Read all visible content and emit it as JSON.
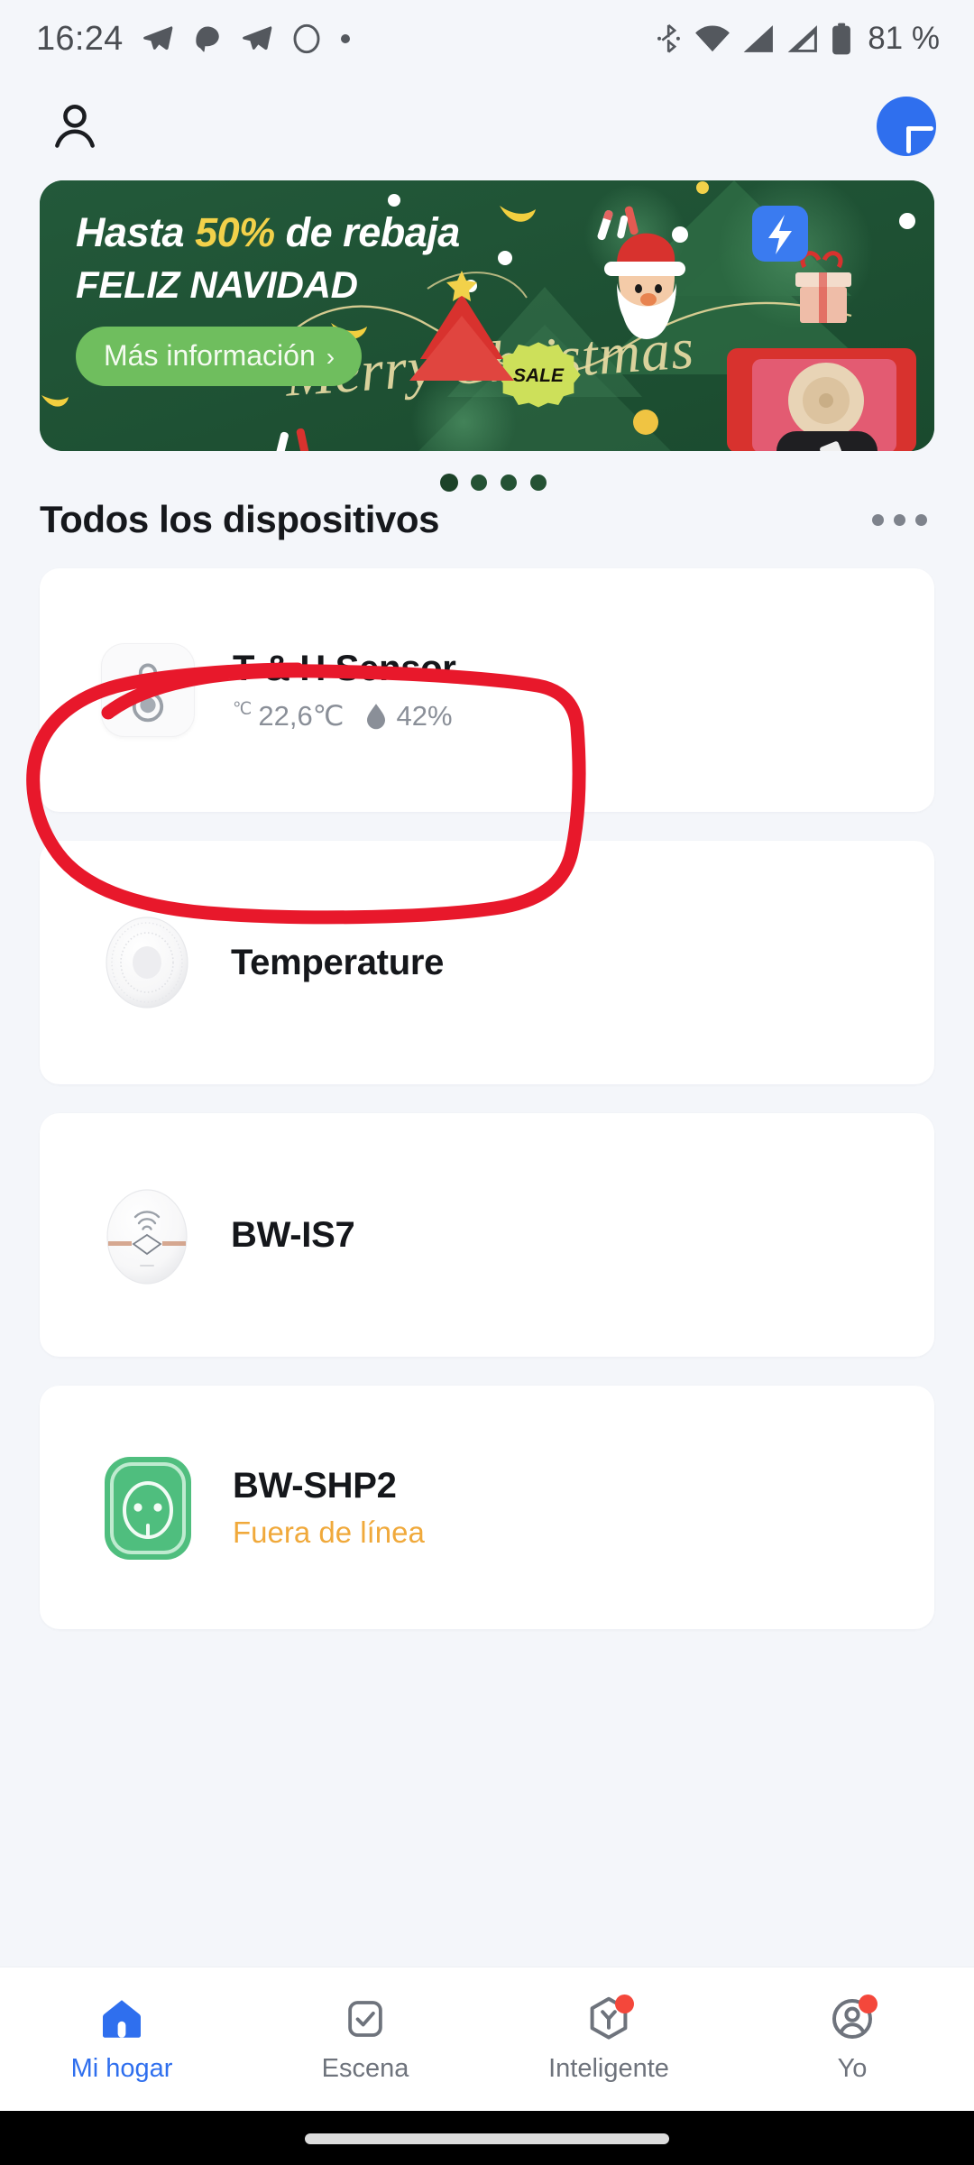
{
  "status_bar": {
    "time": "16:24",
    "battery_percent": "81 %",
    "left_icons": [
      "telegram-icon",
      "chat-bubble-icon",
      "telegram-icon",
      "circle-outline-icon",
      "dot-icon"
    ],
    "right_icons": [
      "bluetooth-icon",
      "wifi-icon",
      "signal-icon",
      "signal-icon",
      "battery-icon"
    ]
  },
  "header": {
    "profile_icon": "person-icon",
    "add_label": "+",
    "add_icon": "plus-icon"
  },
  "banner": {
    "line1_prefix": "Hasta ",
    "line1_percent": "50%",
    "line1_suffix": " de rebaja",
    "line2": "FELIZ NAVIDAD",
    "cta_label": "Más información",
    "cta_chevron": "›",
    "script_text": "Merry Christmas",
    "sale_badge": "SALE",
    "dot_count": 4,
    "colors": {
      "bg_dark": "#1D4E31",
      "accent_yellow": "#F2D14A",
      "cta_green": "#6FBE5E",
      "tree_light": "#2E6B44",
      "santa_red": "#D8322E"
    }
  },
  "section": {
    "title": "Todos los dispositivos",
    "more_icon": "more-horizontal-icon"
  },
  "devices": [
    {
      "name": "T & H Sensor",
      "icon": "thermometer-icon",
      "temp_symbol": "℃",
      "temperature": "22,6℃",
      "humidity_icon": "water-drop-icon",
      "humidity": "42%",
      "status": "",
      "highlighted": true
    },
    {
      "name": "Temperature",
      "icon": "round-sensor-icon",
      "temp_symbol": "",
      "temperature": "",
      "humidity_icon": "",
      "humidity": "",
      "status": "",
      "highlighted": false
    },
    {
      "name": "BW-IS7",
      "icon": "smoke-detector-icon",
      "temp_symbol": "",
      "temperature": "",
      "humidity_icon": "",
      "humidity": "",
      "status": "",
      "highlighted": false
    },
    {
      "name": "BW-SHP2",
      "icon": "smart-plug-icon",
      "temp_symbol": "",
      "temperature": "",
      "humidity_icon": "",
      "humidity": "",
      "status": "Fuera de línea",
      "status_color": "#F0A93B",
      "highlighted": false
    }
  ],
  "annotation": {
    "type": "hand-drawn-ellipse",
    "color": "#E8182B",
    "target": "T & H Sensor"
  },
  "bottom_nav": {
    "items": [
      {
        "label": "Mi hogar",
        "icon": "home-icon",
        "active": true,
        "badge": false
      },
      {
        "label": "Escena",
        "icon": "check-square-icon",
        "active": false,
        "badge": false
      },
      {
        "label": "Inteligente",
        "icon": "shield-y-icon",
        "active": false,
        "badge": true
      },
      {
        "label": "Yo",
        "icon": "account-circle-icon",
        "active": false,
        "badge": true
      }
    ],
    "active_color": "#2F6FEE",
    "inactive_color": "#6E737C",
    "badge_color": "#F4473B"
  }
}
